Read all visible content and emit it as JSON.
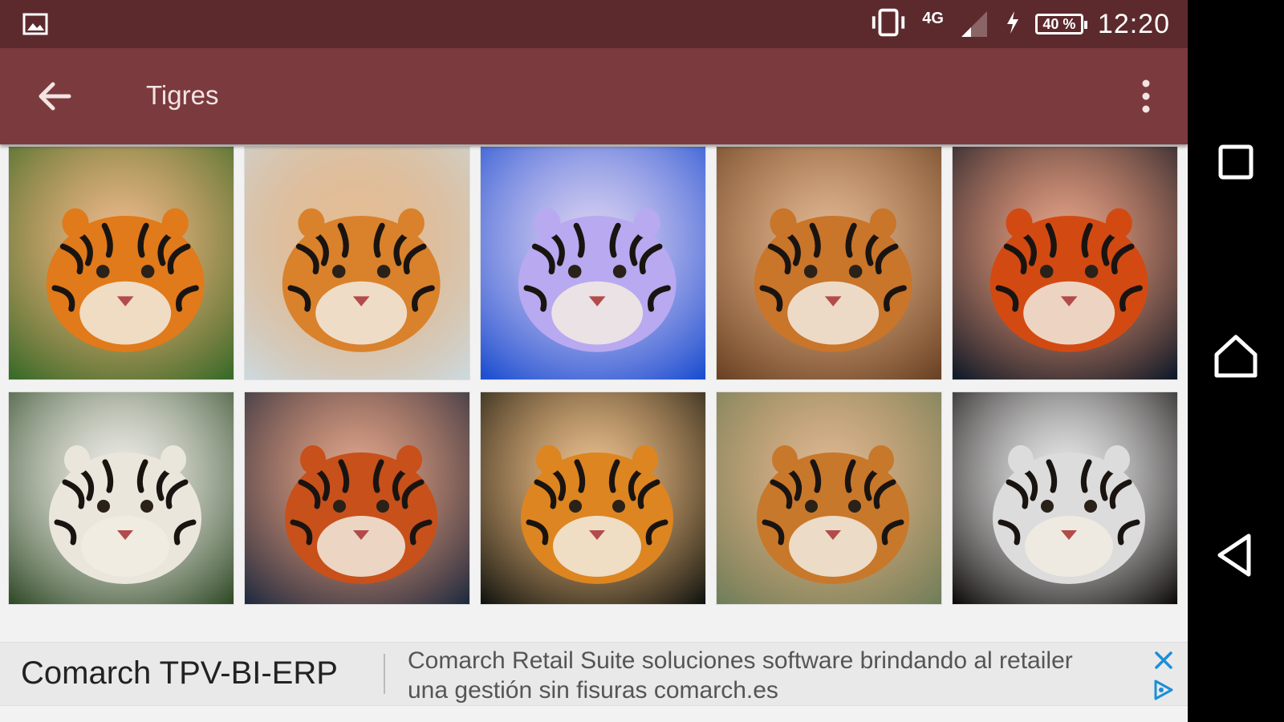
{
  "status_bar": {
    "network": "4G",
    "battery": "40 %",
    "time": "12:20"
  },
  "app_bar": {
    "title": "Tigres"
  },
  "gallery": {
    "tiles": [
      {
        "scene": "tiger-collage",
        "bg": "#3a6b2a",
        "accent": "#e07a1a"
      },
      {
        "scene": "tigers-in-snow",
        "bg": "#cdd8dc",
        "accent": "#d9822b"
      },
      {
        "scene": "blue-tigers-night",
        "bg": "#1d4fd0",
        "accent": "#b8a9f0"
      },
      {
        "scene": "tiger-face-closeup",
        "bg": "#6b4326",
        "accent": "#c9752a"
      },
      {
        "scene": "tiger-fire-moon",
        "bg": "#121c2a",
        "accent": "#d24a12"
      },
      {
        "scene": "white-tigers-jungle",
        "bg": "#2f4a26",
        "accent": "#eae6dc"
      },
      {
        "scene": "tiger-face-bokeh",
        "bg": "#1f2b40",
        "accent": "#c8501a"
      },
      {
        "scene": "tiger-crouching-dark",
        "bg": "#101410",
        "accent": "#dd8520"
      },
      {
        "scene": "tiger-in-frame",
        "bg": "#6f7e5a",
        "accent": "#c8782a"
      },
      {
        "scene": "white-tiger-dark",
        "bg": "#0e0b0a",
        "accent": "#dcdcdc"
      }
    ]
  },
  "ad_banner": {
    "title": "Comarch TPV-BI-ERP",
    "description": "Comarch Retail Suite soluciones software brindando al retailer una gestión sin fisuras comarch.es"
  },
  "colors": {
    "status_bar": "#5c2a2d",
    "app_bar": "#7b3a3d",
    "ad_accent": "#1a8fd8"
  }
}
